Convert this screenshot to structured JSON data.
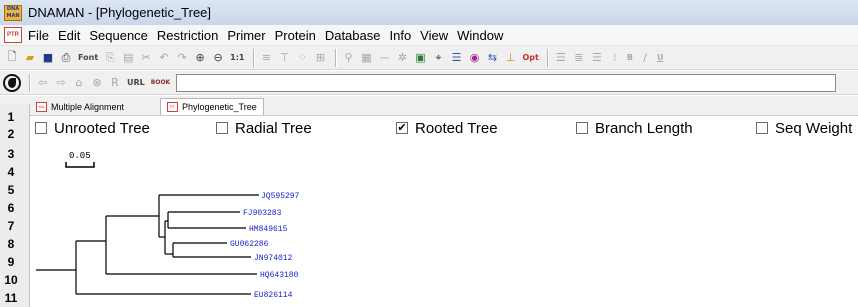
{
  "app": {
    "logo_text": "DNA MAN",
    "title": "DNAMAN - [Phylogenetic_Tree]"
  },
  "menu": {
    "doc_icon_text": "PTR",
    "items": [
      "File",
      "Edit",
      "Sequence",
      "Restriction",
      "Primer",
      "Protein",
      "Database",
      "Info",
      "View",
      "Window"
    ]
  },
  "toolbar": {
    "font_label": "Font",
    "zoom_label": "1:1",
    "opt_label": "Opt",
    "bold_label": "B",
    "underline_label": "U"
  },
  "nav": {
    "url_label": "URL",
    "book_label": "BOOK",
    "url_value": ""
  },
  "tabs": [
    {
      "label": "Multiple Alignment",
      "icon_text": "MA"
    },
    {
      "label": "Phylogenetic_Tree",
      "icon_text": "PT",
      "active": true
    }
  ],
  "row_numbers": [
    "1",
    "2",
    "3",
    "4",
    "5",
    "6",
    "7",
    "8",
    "9",
    "10",
    "11"
  ],
  "options": [
    {
      "label": "Unrooted Tree",
      "checked": false
    },
    {
      "label": "Radial Tree",
      "checked": false
    },
    {
      "label": "Rooted Tree",
      "checked": true
    },
    {
      "label": "Branch Length",
      "checked": false
    },
    {
      "label": "Seq Weight",
      "checked": false
    }
  ],
  "check_mark": "✔",
  "tree": {
    "scale_label": "0.05",
    "leaves": [
      "JQ595297",
      "FJ903283",
      "HM849615",
      "GU062286",
      "JN974012",
      "HQ643180",
      "EU826114"
    ],
    "leaf_color": "#1a22cc"
  }
}
